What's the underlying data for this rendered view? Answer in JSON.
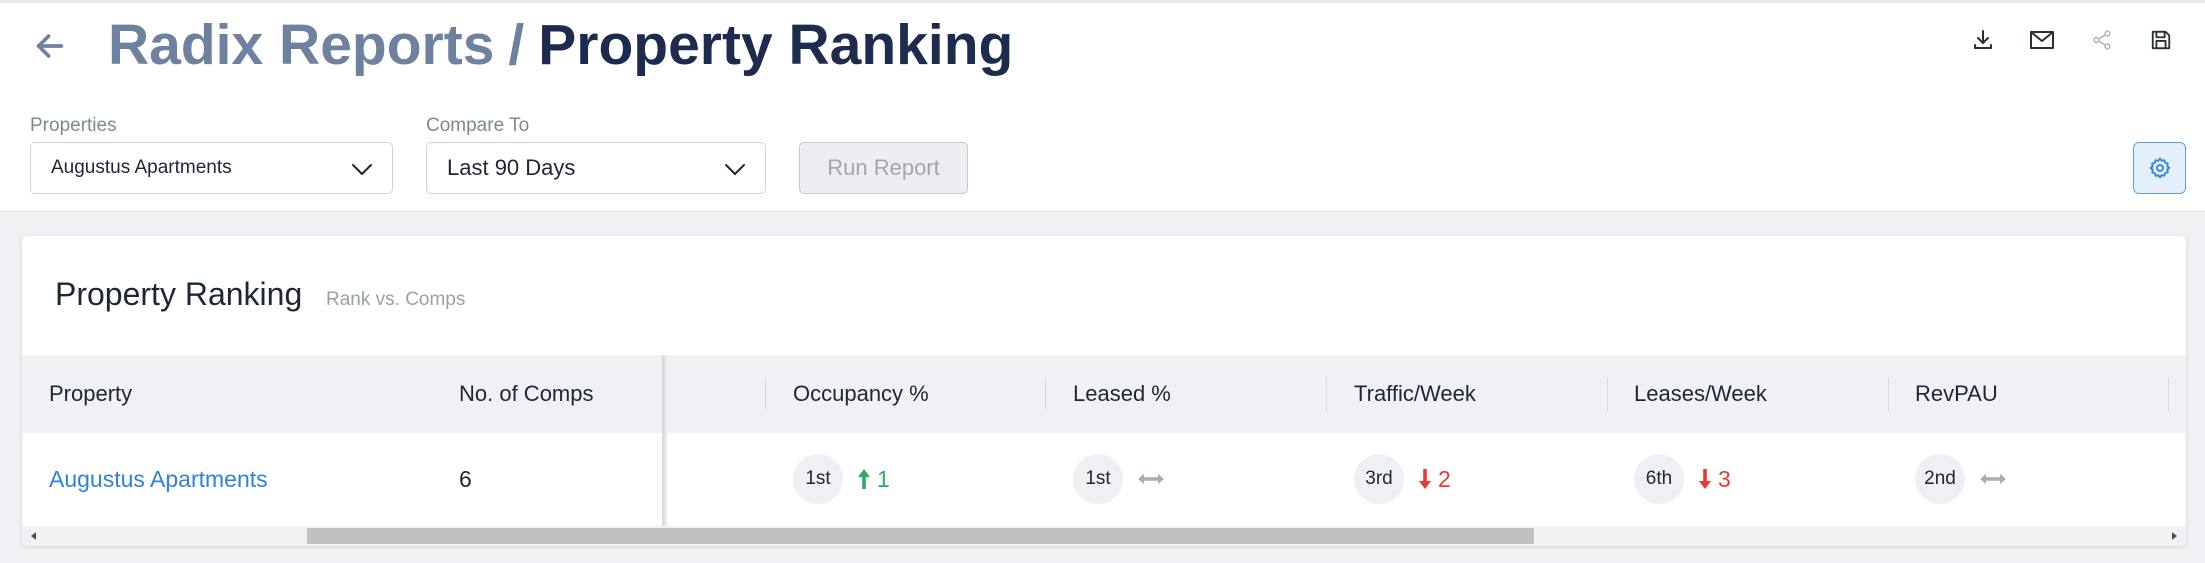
{
  "header": {
    "breadcrumb_parent": "Radix Reports",
    "separator": "/",
    "page_title": "Property Ranking"
  },
  "toolbar": {
    "icons": [
      "download-icon",
      "mail-icon",
      "share-icon",
      "save-icon"
    ]
  },
  "filters": {
    "properties_label": "Properties",
    "properties_value": "Augustus Apartments",
    "compare_label": "Compare To",
    "compare_value": "Last 90 Days",
    "run_label": "Run Report"
  },
  "card": {
    "title": "Property Ranking",
    "subtitle": "Rank vs. Comps"
  },
  "table": {
    "columns": {
      "property": "Property",
      "comps": "No. of Comps",
      "occupancy": "Occupancy %",
      "leased": "Leased %",
      "traffic": "Traffic/Week",
      "leases": "Leases/Week",
      "revpau": "RevPAU"
    },
    "row": {
      "property": "Augustus Apartments",
      "comps": "6",
      "occupancy": {
        "rank": "1st",
        "trend": "up",
        "change": "1"
      },
      "leased": {
        "rank": "1st",
        "trend": "flat",
        "change": ""
      },
      "traffic": {
        "rank": "3rd",
        "trend": "down",
        "change": "2"
      },
      "leases": {
        "rank": "6th",
        "trend": "down",
        "change": "3"
      },
      "revpau": {
        "rank": "2nd",
        "trend": "flat",
        "change": ""
      }
    }
  },
  "colors": {
    "accent": "#2f82d9",
    "trend_up": "#27ae60",
    "trend_down": "#e53935",
    "trend_flat": "#a8adb5"
  }
}
